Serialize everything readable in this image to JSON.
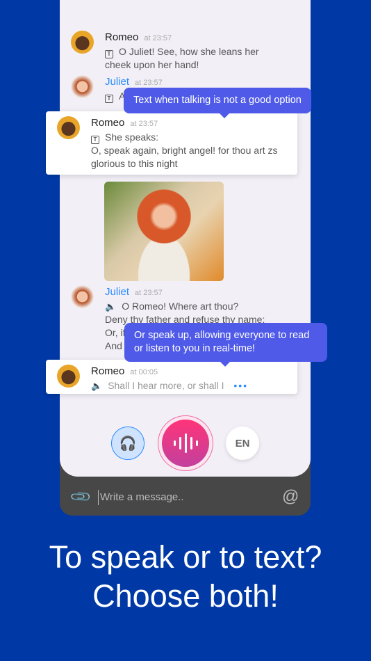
{
  "messages": [
    {
      "name": "Romeo",
      "time": "at 23:57",
      "mode": "text-icon",
      "text": "O Juliet! See, how she leans her cheek upon her hand!"
    },
    {
      "name": "Juliet",
      "time": "at 23:57",
      "mode": "text-icon",
      "text": "A"
    },
    {
      "name": "Romeo",
      "time": "at 23:57",
      "mode": "text-icon",
      "text": "She speaks:",
      "text2": "O, speak again, bright angel! for thou art zs glorious to this night"
    },
    {
      "name": "Juliet",
      "time": "at 23:57",
      "mode": "speaker-icon",
      "text": "O Romeo! Where art thou?",
      "text2": "Deny thy father and refuse thy name:",
      "text3": "Or, if",
      "text4": "And"
    },
    {
      "name": "Romeo",
      "time": "at 00:05",
      "mode": "speaker-icon",
      "text": "Shall I hear more, or shall I"
    }
  ],
  "tooltips": {
    "text": "Text when talking is not a good option",
    "speak": "Or speak up, allowing everyone to read or listen to you in real-time!"
  },
  "controls": {
    "language": "EN",
    "listen_icon": "headphones-icon",
    "mic_icon": "voice-wave-icon"
  },
  "composer": {
    "placeholder": "Write a message..",
    "attach_icon": "paperclip-icon",
    "mention_icon": "at-icon"
  },
  "headline": {
    "line1": "To speak or to text?",
    "line2": "Choose both!"
  },
  "colors": {
    "background": "#0039a6",
    "tooltip": "#4f5ae8",
    "mic": "#f0387a",
    "accent": "#2a8cff"
  }
}
